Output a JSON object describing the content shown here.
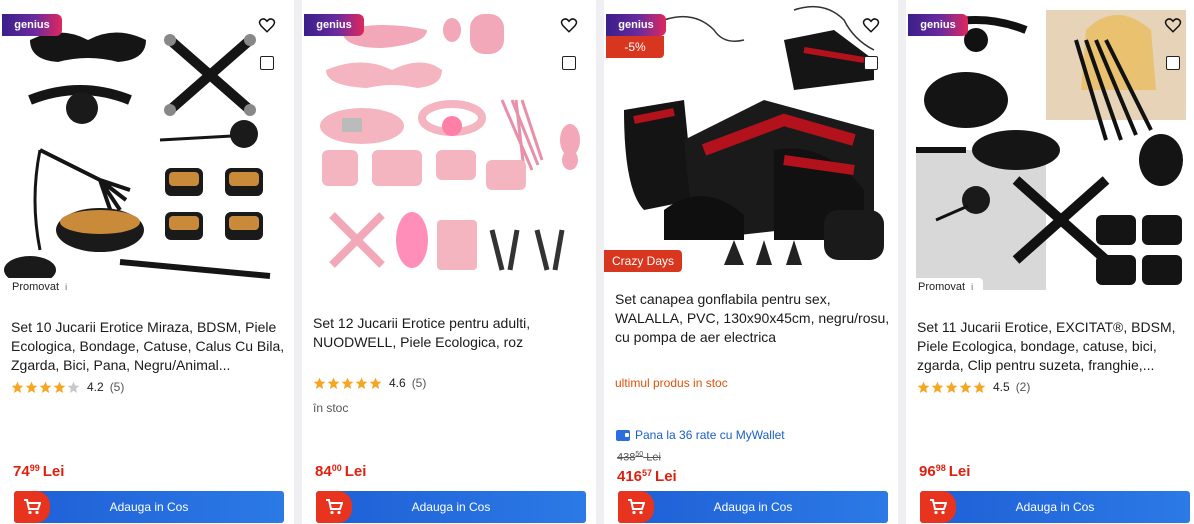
{
  "badges": {
    "genius": "genius",
    "promovat": "Promovat",
    "info": "i"
  },
  "colors": {
    "accent_red": "#e0200f",
    "button_blue": "#1f5fd6",
    "star": "#f5a623",
    "genius_from": "#3a1f8a",
    "genius_to": "#e0275c"
  },
  "products": [
    {
      "title": "Set 10 Jucarii Erotice Miraza, BDSM, Piele Ecologica, Bondage, Catuse, Calus Cu Bila, Zgarda, Bici, Pana, Negru/Animal...",
      "rating": "4.2",
      "reviews": "(5)",
      "rating_value": 4.2,
      "price_main": "74",
      "price_dec": "99",
      "currency": "Lei",
      "cart_label": "Adauga in Cos"
    },
    {
      "title": "Set 12 Jucarii Erotice pentru adulti, NUODWELL, Piele Ecologica, roz",
      "rating": "4.6",
      "reviews": "(5)",
      "rating_value": 4.6,
      "stock": "în stoc",
      "price_main": "84",
      "price_dec": "00",
      "currency": "Lei",
      "cart_label": "Adauga in Cos"
    },
    {
      "title": "Set canapea gonflabila pentru sex, WALALLA, PVC, 130x90x45cm, negru/rosu, cu pompa de aer electrica",
      "discount": "-5%",
      "campaign": "Crazy Days",
      "stock": "ultimul produs in stoc",
      "wallet": "Pana la 36 rate cu MyWallet",
      "old_main": "438",
      "old_dec": "50",
      "old_currency": "Lei",
      "price_main": "416",
      "price_dec": "57",
      "currency": "Lei",
      "cart_label": "Adauga in Cos"
    },
    {
      "title": "Set 11 Jucarii Erotice, EXCITAT®, BDSM, Piele Ecologica, bondage, catuse, bici, zgarda, Clip pentru suzeta, franghie,...",
      "rating": "4.5",
      "reviews": "(2)",
      "rating_value": 4.5,
      "price_main": "96",
      "price_dec": "98",
      "currency": "Lei",
      "cart_label": "Adauga in Cos"
    }
  ]
}
